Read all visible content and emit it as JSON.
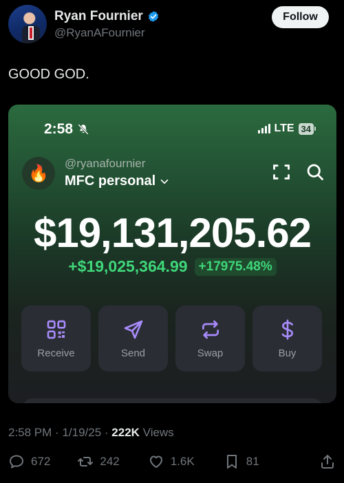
{
  "author": {
    "name": "Ryan Fournier",
    "handle": "@RyanAFournier",
    "verified_color": "#1d9bf0"
  },
  "follow_label": "Follow",
  "tweet_text": "GOOD GOD.",
  "screenshot": {
    "status_time": "2:58",
    "network": "LTE",
    "battery": "34",
    "account_handle": "@ryanafournier",
    "account_name": "MFC personal",
    "balance": "$19,131,205.62",
    "change_abs": "+$19,025,364.99",
    "change_pct": "+17975.48%",
    "accent_color": "#3fd77a",
    "actions": [
      {
        "label": "Receive",
        "icon": "qr-code-icon"
      },
      {
        "label": "Send",
        "icon": "send-icon"
      },
      {
        "label": "Swap",
        "icon": "swap-icon"
      },
      {
        "label": "Buy",
        "icon": "dollar-icon"
      }
    ]
  },
  "meta": {
    "time": "2:58 PM",
    "date": "1/19/25",
    "views_count": "222K",
    "views_label": "Views"
  },
  "engagement": {
    "replies": "672",
    "retweets": "242",
    "likes": "1.6K",
    "bookmarks": "81"
  }
}
